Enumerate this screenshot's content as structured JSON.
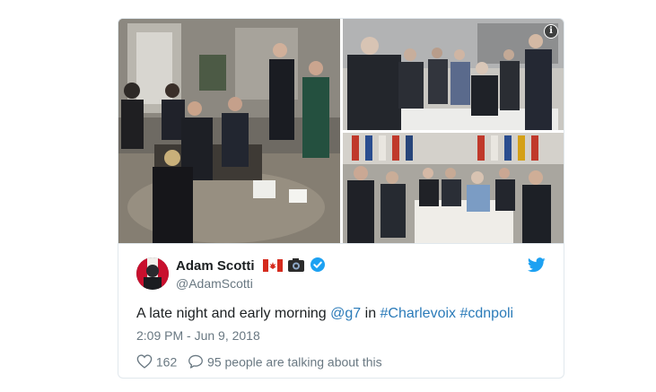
{
  "tweet": {
    "name": "Adam Scotti",
    "handle": "@AdamScotti",
    "text_pre": "A late night and early morning ",
    "mention": "@g7",
    "text_mid": " in ",
    "hashtag1": "#Charlevoix",
    "space": " ",
    "hashtag2": "#cdnpoli",
    "timestamp": "2:09 PM - Jun 9, 2018",
    "likes": "162",
    "replies_text": "95 people are talking about this"
  },
  "media": {
    "info_glyph": "i",
    "photo_count": 3
  },
  "icons": {
    "flag": "canada-flag-icon",
    "camera": "camera-icon",
    "verified": "verified-badge-icon",
    "brand": "twitter-bird-icon",
    "like": "heart-icon",
    "reply": "speech-bubble-icon",
    "info": "info-icon"
  },
  "colors": {
    "link": "#2b7bb9",
    "verified": "#1da1f2",
    "twitter_brand": "#1da1f2",
    "text": "#1c2022",
    "secondary_text": "#697882",
    "border": "#e1e8ed"
  }
}
